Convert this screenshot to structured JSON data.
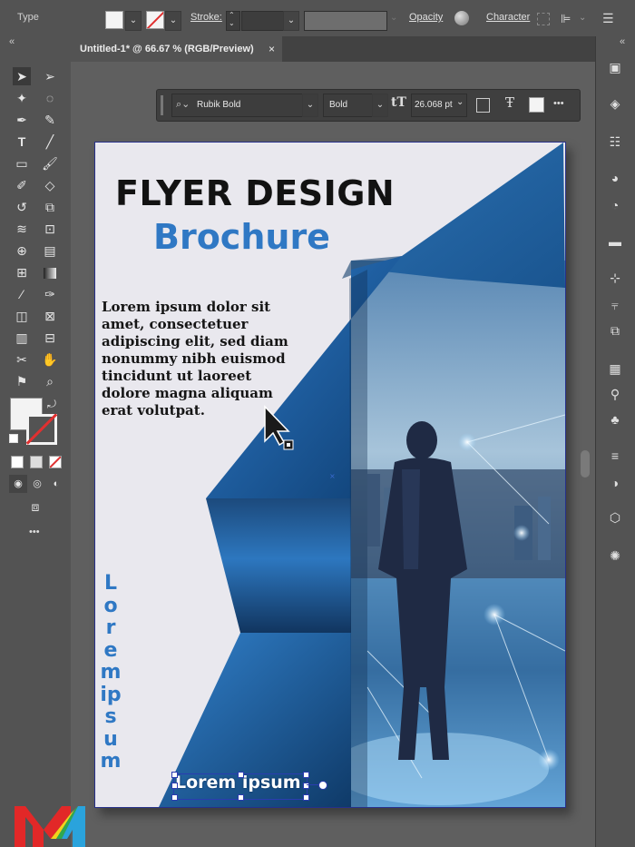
{
  "control_bar": {
    "type_label": "Type",
    "stroke_label": "Stroke:",
    "opacity_label": "Opacity",
    "character_label": "Character"
  },
  "document_tab": {
    "title": "Untitled-1* @ 66.67 % (RGB/Preview)",
    "close_glyph": "×"
  },
  "panel_collapse_left": "«",
  "panel_collapse_right": "«",
  "context_bar": {
    "font_family": "Rubik Bold",
    "font_style": "Bold",
    "font_size": "26.068 pt",
    "more_glyph": "•••"
  },
  "flyer": {
    "title": "FLYER DESIGN",
    "subtitle": "Brochure",
    "body": "Lorem ipsum dolor sit amet, consectetuer adipiscing elit, sed diam nonummy nibh euismod tincidunt ut laoreet dolore magna aliquam erat volutpat.",
    "vertical_text": "Loremipsum",
    "footer_text": "Lorem ipsum"
  },
  "toolbar_more": "•••",
  "colors": {
    "app_bg": "#535353",
    "artboard_bg": "#e9e8ee",
    "flyer_blue": "#2f78c4",
    "panel_dark": "#3f3f3f"
  }
}
